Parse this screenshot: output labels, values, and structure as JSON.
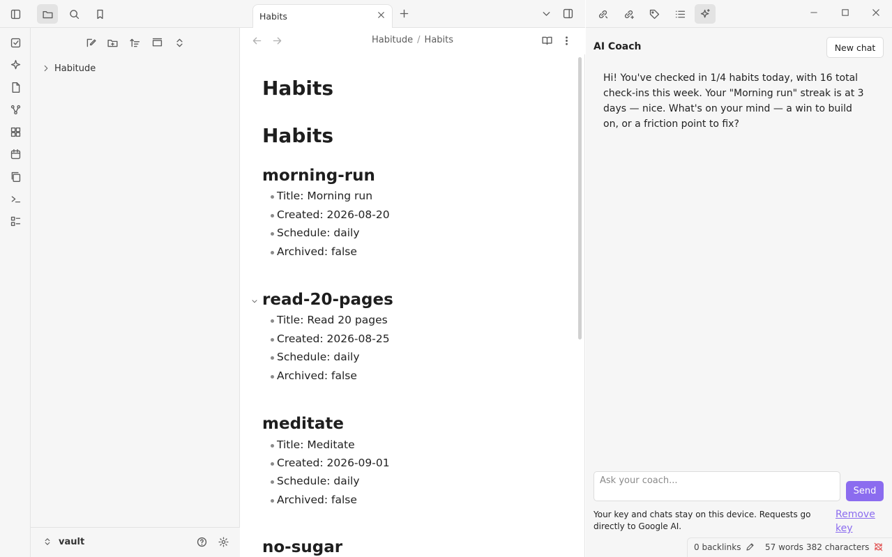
{
  "ribbon": {
    "items": [
      {
        "icon": "checkbox-icon"
      },
      {
        "icon": "sparkle-icon"
      },
      {
        "icon": "file-open-icon"
      },
      {
        "icon": "graph-icon"
      },
      {
        "icon": "grid-icon"
      },
      {
        "icon": "calendar-icon"
      },
      {
        "icon": "copy-icon"
      },
      {
        "icon": "terminal-icon"
      },
      {
        "icon": "list-icon"
      }
    ]
  },
  "sidebar": {
    "tree": [
      {
        "label": "Habitude",
        "collapsed": true
      }
    ],
    "vault_name": "vault"
  },
  "tab": {
    "title": "Habits"
  },
  "breadcrumb": {
    "parent": "Habitude",
    "separator": "/",
    "current": "Habits"
  },
  "document": {
    "title": "Habits",
    "heading": "Habits",
    "habits": [
      {
        "id": "morning-run",
        "props": [
          "Title: Morning run",
          "Created: 2026-08-20",
          "Schedule: daily",
          "Archived: false"
        ]
      },
      {
        "id": "read-20-pages",
        "props": [
          "Title: Read 20 pages",
          "Created: 2026-08-25",
          "Schedule: daily",
          "Archived: false"
        ]
      },
      {
        "id": "meditate",
        "props": [
          "Title: Meditate",
          "Created: 2026-09-01",
          "Schedule: daily",
          "Archived: false"
        ]
      },
      {
        "id": "no-sugar",
        "props": []
      }
    ]
  },
  "coach": {
    "title": "AI Coach",
    "new_chat": "New chat",
    "message": "Hi! You've checked in 1/4 habits today, with 16 total check-ins this week. Your \"Morning run\" streak is at 3 days — nice. What's on your mind — a win to build on, or a friction point to fix?",
    "input_placeholder": "Ask your coach...",
    "send": "Send",
    "privacy": "Your key and chats stay on this device. Requests go directly to Google AI.",
    "remove_key": "Remove key"
  },
  "status": {
    "backlinks": "0 backlinks",
    "words": "57 words",
    "characters": "382 characters"
  },
  "colors": {
    "accent": "#8b6cef",
    "sidebar_bg": "#f6f6f6",
    "border": "#e3e3e3"
  }
}
